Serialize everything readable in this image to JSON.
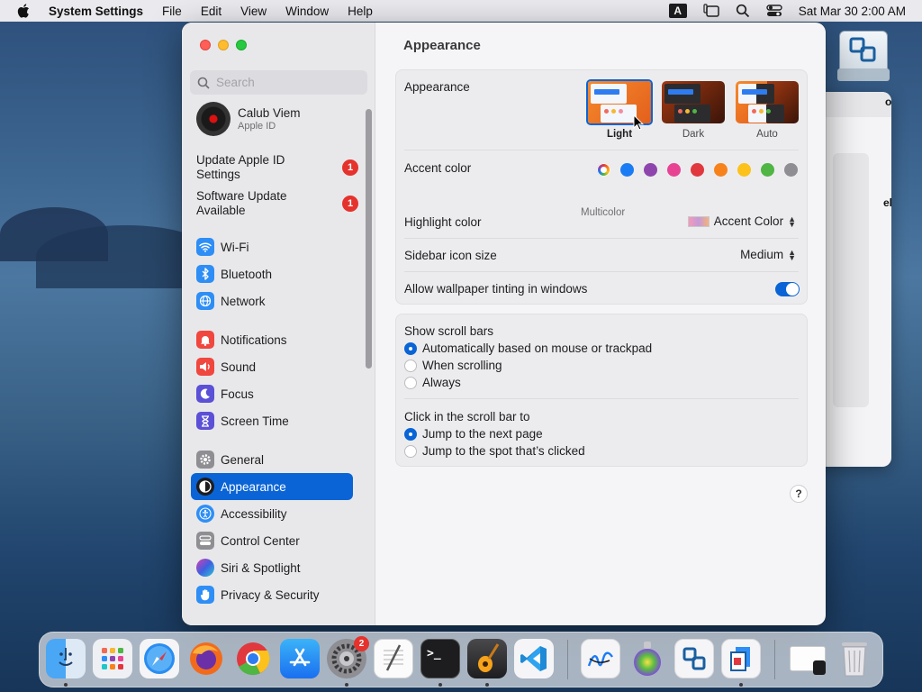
{
  "menubar": {
    "app_name": "System Settings",
    "menus": [
      "File",
      "Edit",
      "View",
      "Window",
      "Help"
    ],
    "input_source": "A",
    "datetime": "Sat Mar 30  2:00 AM"
  },
  "background_window": {
    "partial_title": "on",
    "partial_label": "els"
  },
  "sidebar": {
    "search_placeholder": "Search",
    "profile": {
      "name": "Calub Viem",
      "subtitle": "Apple ID"
    },
    "alerts": [
      {
        "label": "Update Apple ID Settings",
        "badge": "1"
      },
      {
        "label": "Software Update Available",
        "badge": "1"
      }
    ],
    "items": [
      {
        "label": "Wi-Fi",
        "icon": "wifi-icon",
        "color": "#2e8ef5"
      },
      {
        "label": "Bluetooth",
        "icon": "bluetooth-icon",
        "color": "#2e8ef5"
      },
      {
        "label": "Network",
        "icon": "globe-icon",
        "color": "#2e8ef5"
      },
      {
        "label": "Notifications",
        "icon": "bell-icon",
        "color": "#f0473f"
      },
      {
        "label": "Sound",
        "icon": "speaker-icon",
        "color": "#f0473f"
      },
      {
        "label": "Focus",
        "icon": "moon-icon",
        "color": "#5b50d6"
      },
      {
        "label": "Screen Time",
        "icon": "hourglass-icon",
        "color": "#5b50d6"
      },
      {
        "label": "General",
        "icon": "gear-icon",
        "color": "#8e8e93"
      },
      {
        "label": "Appearance",
        "icon": "appearance-icon",
        "color": "#1d1d1f",
        "selected": true
      },
      {
        "label": "Accessibility",
        "icon": "accessibility-icon",
        "color": "#2e8ef5"
      },
      {
        "label": "Control Center",
        "icon": "toggles-icon",
        "color": "#8e8e93"
      },
      {
        "label": "Siri & Spotlight",
        "icon": "siri-icon",
        "color": "#7a3fd4"
      },
      {
        "label": "Privacy & Security",
        "icon": "hand-icon",
        "color": "#2e8ef5"
      }
    ]
  },
  "content": {
    "title": "Appearance",
    "appearance": {
      "label": "Appearance",
      "options": [
        {
          "label": "Light",
          "selected": true
        },
        {
          "label": "Dark",
          "selected": false
        },
        {
          "label": "Auto",
          "selected": false
        }
      ]
    },
    "accent": {
      "label": "Accent color",
      "caption": "Multicolor",
      "colors": [
        "multicolor",
        "#1a7cf5",
        "#8e44ad",
        "#e84393",
        "#e0383e",
        "#f7821b",
        "#fcc21b",
        "#4fb543",
        "#8e8e93"
      ]
    },
    "highlight": {
      "label": "Highlight color",
      "value": "Accent Color"
    },
    "sidebar_icon_size": {
      "label": "Sidebar icon size",
      "value": "Medium"
    },
    "wallpaper_tinting": {
      "label": "Allow wallpaper tinting in windows",
      "enabled": true
    },
    "scroll_bars": {
      "label": "Show scroll bars",
      "options": [
        {
          "label": "Automatically based on mouse or trackpad",
          "selected": true
        },
        {
          "label": "When scrolling",
          "selected": false
        },
        {
          "label": "Always",
          "selected": false
        }
      ]
    },
    "click_scroll": {
      "label": "Click in the scroll bar to",
      "options": [
        {
          "label": "Jump to the next page",
          "selected": true
        },
        {
          "label": "Jump to the spot that’s clicked",
          "selected": false
        }
      ]
    },
    "help_label": "?"
  },
  "dock": {
    "items": [
      {
        "name": "finder",
        "running": true
      },
      {
        "name": "launchpad",
        "running": false
      },
      {
        "name": "safari",
        "running": false
      },
      {
        "name": "firefox",
        "running": false
      },
      {
        "name": "chrome",
        "running": false
      },
      {
        "name": "app-store",
        "running": false
      },
      {
        "name": "system-settings",
        "running": true,
        "badge": "2"
      },
      {
        "name": "textedit",
        "running": false
      },
      {
        "name": "terminal",
        "running": true
      },
      {
        "name": "garageband",
        "running": true
      },
      {
        "name": "vscode",
        "running": false
      },
      {
        "name": "freeform",
        "running": false
      },
      {
        "name": "disk-utility",
        "running": false
      },
      {
        "name": "migration-assistant",
        "running": false
      },
      {
        "name": "workspace",
        "running": true
      },
      {
        "name": "downloads",
        "running": false
      },
      {
        "name": "trash",
        "running": false
      }
    ]
  }
}
